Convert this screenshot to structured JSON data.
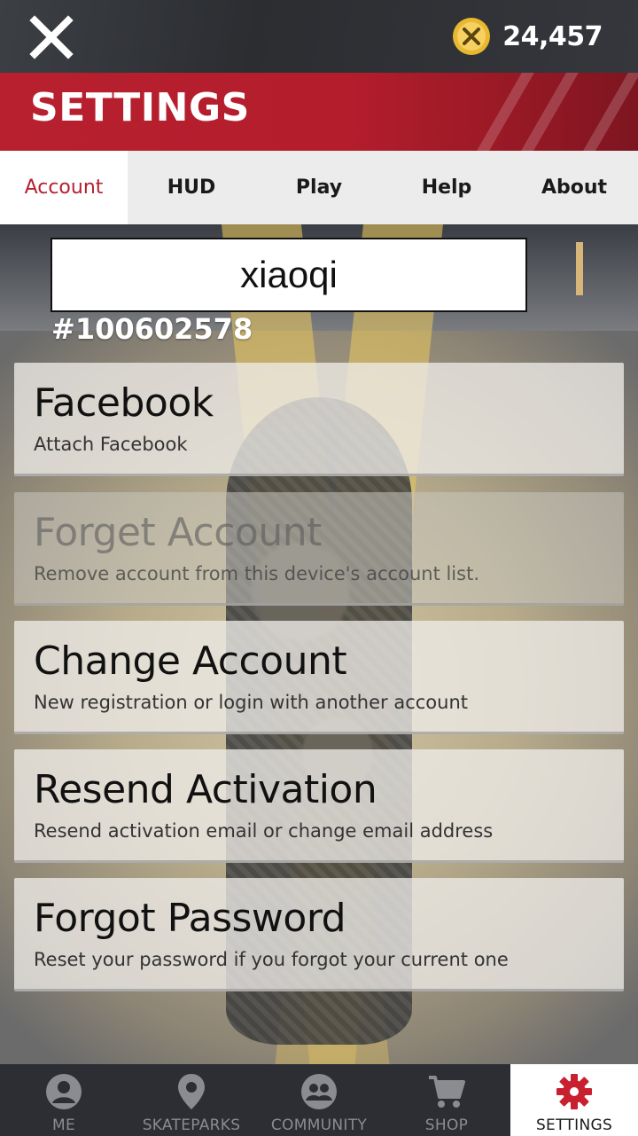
{
  "topbar": {
    "close_icon": "close-icon",
    "coin_icon": "coin-icon",
    "coins": "24,457"
  },
  "header": {
    "title": "SETTINGS",
    "accent_color": "#b8202f"
  },
  "tabs": [
    {
      "label": "Account",
      "active": true
    },
    {
      "label": "HUD",
      "active": false
    },
    {
      "label": "Play",
      "active": false
    },
    {
      "label": "Help",
      "active": false
    },
    {
      "label": "About",
      "active": false
    }
  ],
  "account": {
    "username": "xiaoqi",
    "user_id": "#100602578"
  },
  "options": [
    {
      "title": "Facebook",
      "description": "Attach Facebook",
      "enabled": true
    },
    {
      "title": "Forget Account",
      "description": "Remove account from this device's account list.",
      "enabled": false
    },
    {
      "title": "Change Account",
      "description": "New registration or login with another account",
      "enabled": true
    },
    {
      "title": "Resend Activation",
      "description": "Resend activation email or change email address",
      "enabled": true
    },
    {
      "title": "Forgot Password",
      "description": "Reset your password if you forgot your current one",
      "enabled": true
    }
  ],
  "bottom_nav": [
    {
      "label": "ME",
      "icon": "user-icon",
      "active": false
    },
    {
      "label": "SKATEPARKS",
      "icon": "map-pin-icon",
      "active": false
    },
    {
      "label": "COMMUNITY",
      "icon": "community-icon",
      "active": false
    },
    {
      "label": "SHOP",
      "icon": "cart-icon",
      "active": false
    },
    {
      "label": "SETTINGS",
      "icon": "gear-icon",
      "active": true
    }
  ]
}
